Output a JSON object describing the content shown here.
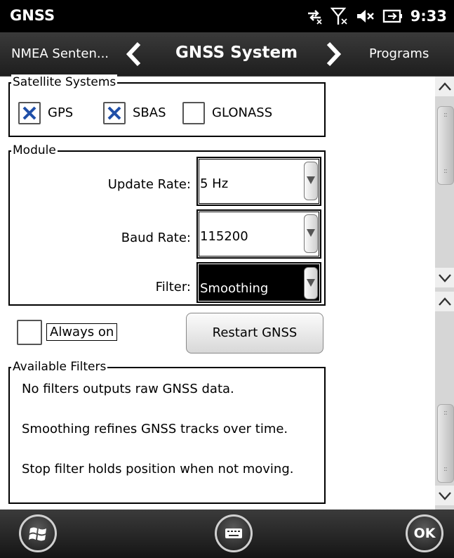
{
  "status": {
    "app_title": "GNSS",
    "time": "9:33",
    "icons": [
      "data-sync-icon",
      "no-signal-icon",
      "speaker-muted-icon",
      "battery-charging-icon"
    ]
  },
  "nav": {
    "prev": "NMEA Senten...",
    "current": "GNSS System",
    "next": "Programs"
  },
  "satellite_systems": {
    "legend": "Satellite Systems",
    "items": [
      {
        "label": "GPS",
        "checked": true
      },
      {
        "label": "SBAS",
        "checked": true
      },
      {
        "label": "GLONASS",
        "checked": false
      }
    ]
  },
  "module": {
    "legend": "Module",
    "update_rate": {
      "label": "Update Rate:",
      "value": "5 Hz"
    },
    "baud_rate": {
      "label": "Baud Rate:",
      "value": "115200"
    },
    "filter": {
      "label": "Filter:",
      "value": "Smoothing"
    }
  },
  "always_on": {
    "label": "Always on",
    "checked": false
  },
  "restart_button": "Restart GNSS",
  "available_filters": {
    "legend": "Available Filters",
    "lines": [
      "No filters outputs raw GNSS data.",
      "Smoothing refines GNSS tracks over time.",
      "Stop filter holds position when not moving."
    ]
  },
  "bottom": {
    "ok_label": "OK"
  },
  "colors": {
    "bar_bg": "#000000",
    "check_mark": "#1f4fa8",
    "selected_bg": "#000000"
  }
}
